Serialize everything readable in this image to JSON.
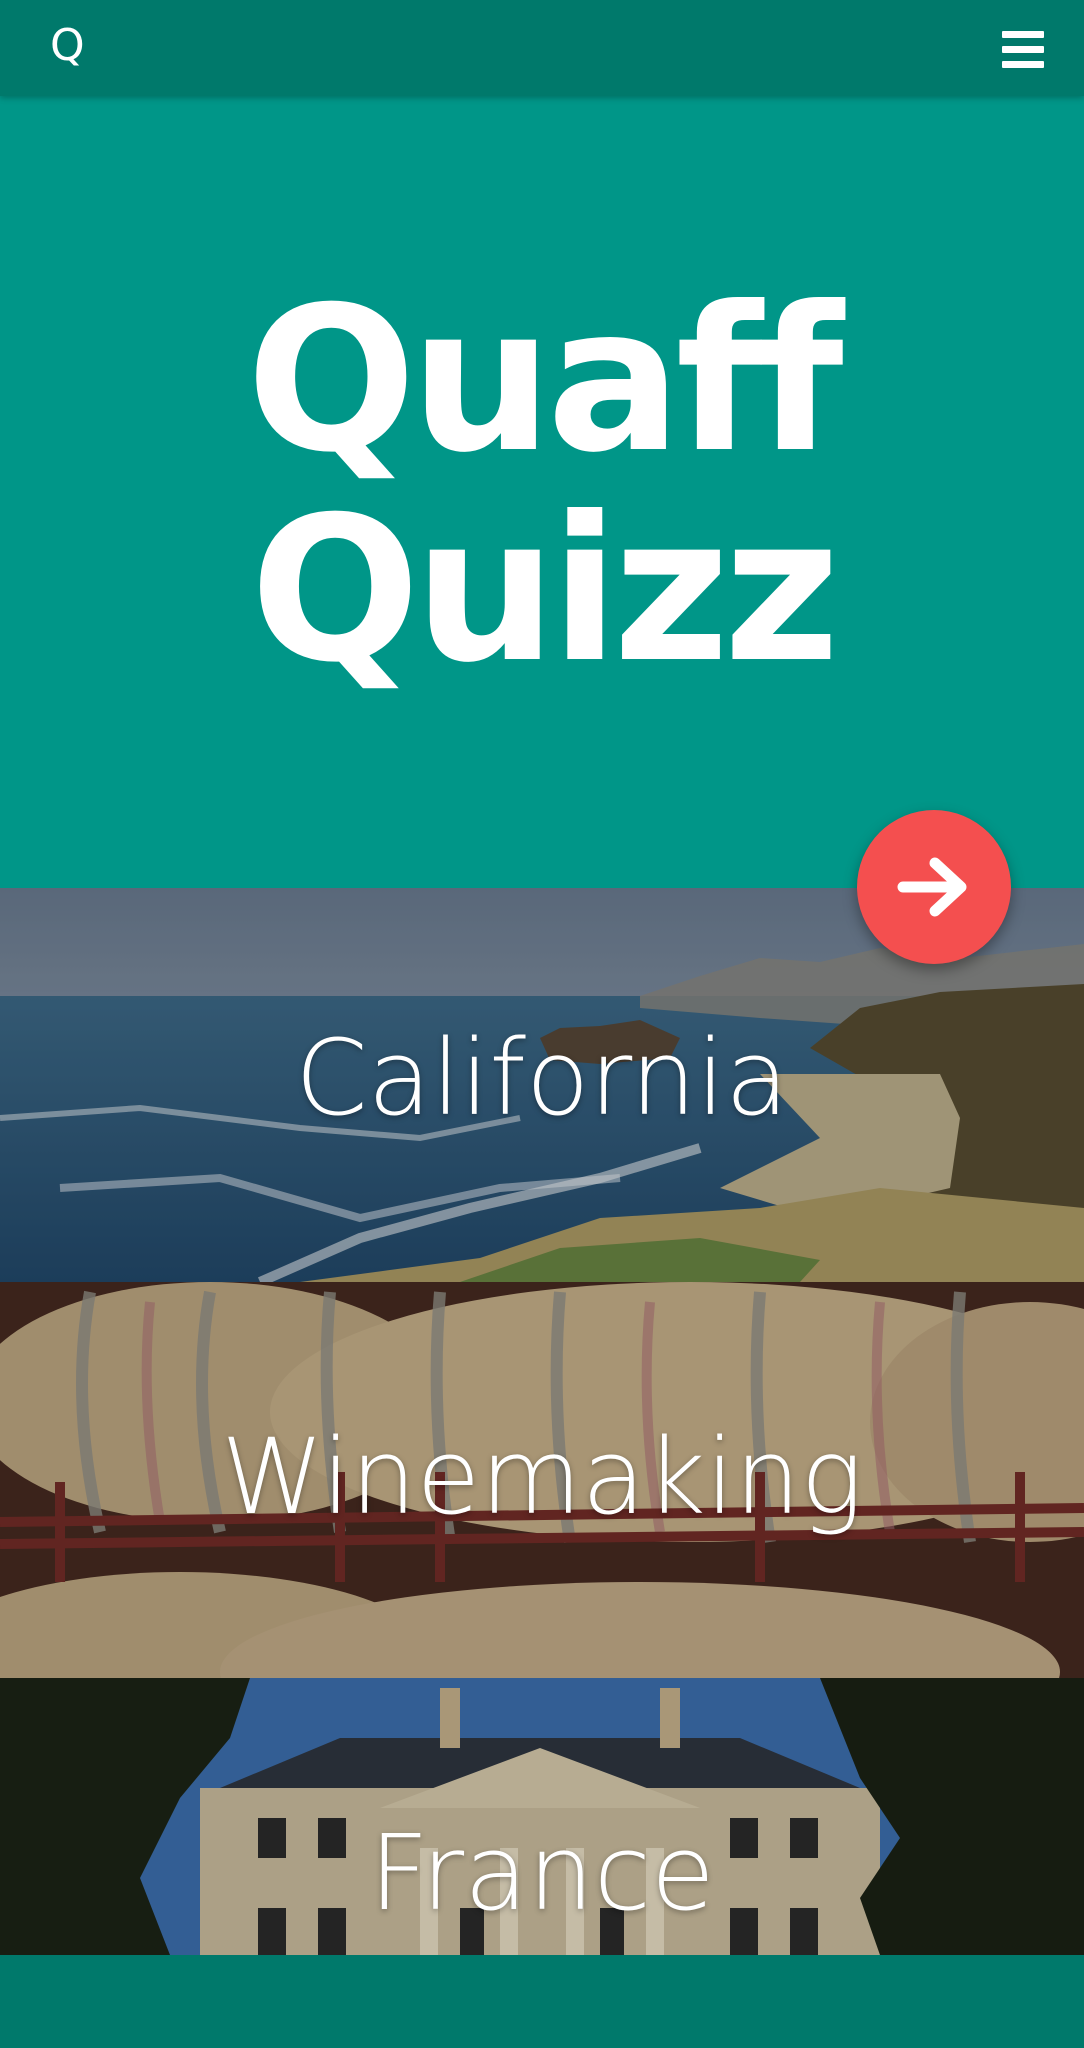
{
  "app": {
    "logo": "Q",
    "title_line1": "Quaff",
    "title_line2": "Quizz"
  },
  "icons": {
    "menu": "hamburger-menu-icon",
    "next": "arrow-right-icon"
  },
  "colors": {
    "topbar": "#00796b",
    "hero": "#009688",
    "fab": "#f44f4f"
  },
  "categories": [
    {
      "label": "California"
    },
    {
      "label": "Winemaking"
    },
    {
      "label": "France"
    }
  ]
}
